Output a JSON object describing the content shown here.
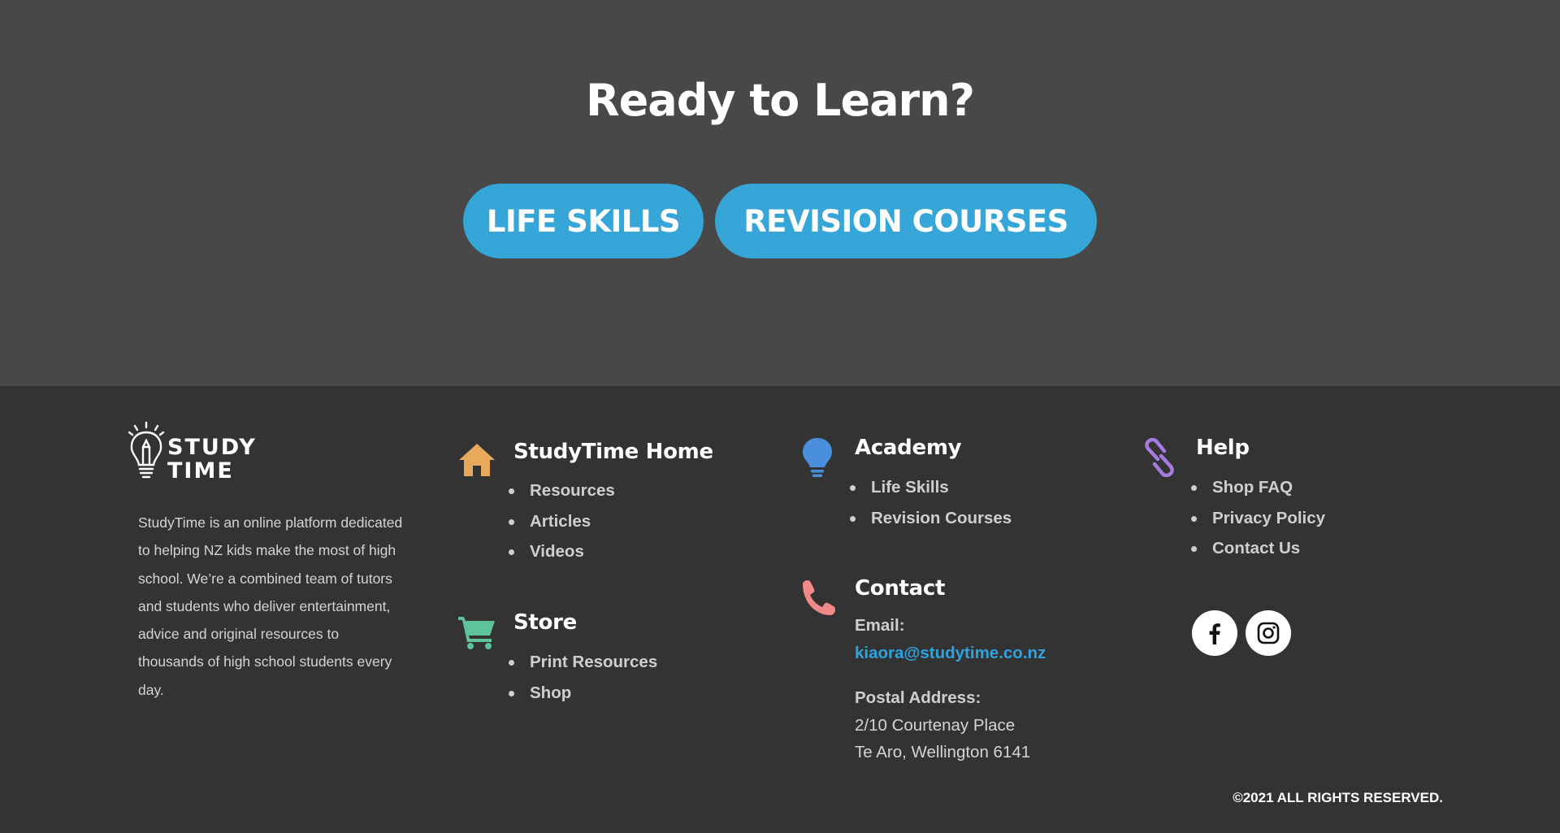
{
  "cta": {
    "title": "Ready to Learn?",
    "buttons": [
      "LIFE SKILLS",
      "REVISION COURSES"
    ],
    "button_color": "#36a6d8"
  },
  "footer": {
    "logo": {
      "line1": "STUDY",
      "line2": "TIME",
      "icon": "lightbulb-pencil-icon"
    },
    "about": "StudyTime is an online platform dedicated to helping NZ kids make the most of high school. We’re a combined team of tutors and students who deliver entertainment, advice and original resources to thousands of high school students every day.",
    "studytime_home": {
      "title": "StudyTime Home",
      "icon": "home-icon",
      "icon_color": "#e8a95c",
      "links": [
        "Resources",
        "Articles",
        "Videos"
      ]
    },
    "store": {
      "title": "Store",
      "icon": "cart-icon",
      "icon_color": "#5cc39a",
      "links": [
        "Print Resources",
        "Shop"
      ]
    },
    "academy": {
      "title": "Academy",
      "icon": "lightbulb-icon",
      "icon_color": "#4a8fdc",
      "links": [
        "Life Skills",
        "Revision Courses"
      ]
    },
    "contact": {
      "title": "Contact",
      "icon": "phone-icon",
      "icon_color": "#f08a8a",
      "email_label": "Email:",
      "email": "kiaora@studytime.co.nz",
      "postal_label": "Postal Address:",
      "address_line1": "2/10 Courtenay Place",
      "address_line2": "Te Aro, Wellington 6141"
    },
    "help": {
      "title": "Help",
      "icon": "link-icon",
      "icon_color": "#a57be0",
      "links": [
        "Shop FAQ",
        "Privacy Policy",
        "Contact Us"
      ]
    },
    "social": [
      "facebook-icon",
      "instagram-icon"
    ],
    "copyright": "©2021 ALL RIGHTS RESERVED."
  }
}
